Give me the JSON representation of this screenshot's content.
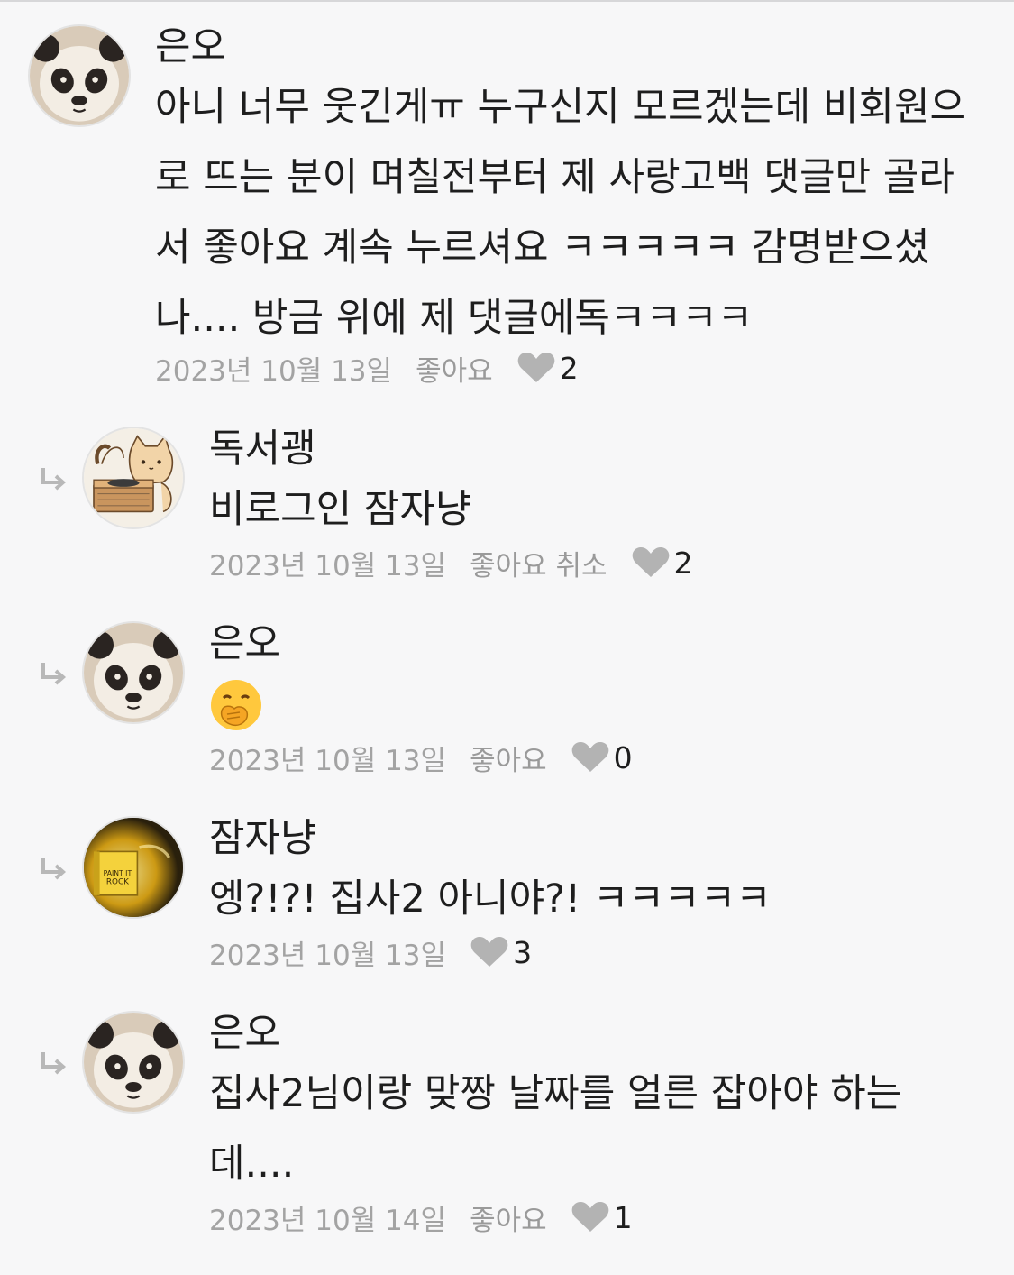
{
  "comments": [
    {
      "author": "은오",
      "text": "아니 너무 웃긴게ㅠ 누구신지 모르겠는데 비회원으로 뜨는 분이 며칠전부터 제 사랑고백 댓글만 골라서 좋아요 계속 누르셔요 ㅋㅋㅋㅋㅋ 감명받으셨나.... 방금 위에 제 댓글에독ㅋㅋㅋㅋ",
      "date": "2023년 10월 13일",
      "like_label": "좋아요",
      "like_count": "2",
      "avatar": "panda-avatar",
      "is_reply": false
    },
    {
      "author": "독서괭",
      "text": "비로그인 잠자냥",
      "date": "2023년 10월 13일",
      "like_label": "좋아요 취소",
      "like_count": "2",
      "avatar": "cat-turntable-avatar",
      "is_reply": true
    },
    {
      "author": "은오",
      "text": "",
      "emoji": "face-with-hand-over-mouth",
      "date": "2023년 10월 13일",
      "like_label": "좋아요",
      "like_count": "0",
      "avatar": "panda-avatar",
      "is_reply": true
    },
    {
      "author": "잠자냥",
      "text": "엥?!?! 집사2 아니야?! ㅋㅋㅋㅋㅋ",
      "date": "2023년 10월 13일",
      "like_label": "",
      "like_count": "3",
      "avatar": "paint-it-rock-book-avatar",
      "is_reply": true
    },
    {
      "author": "은오",
      "text": "집사2님이랑 맞짱 날짜를 얼른 잡아야 하는데....",
      "date": "2023년 10월 14일",
      "like_label": "좋아요",
      "like_count": "1",
      "avatar": "panda-avatar",
      "is_reply": true
    }
  ],
  "colors": {
    "background": "#f7f7f8",
    "text": "#1e1e1e",
    "meta_text": "#a3a3a3",
    "heart": "#b3b3b3",
    "reply_arrow": "#b8b8b8"
  }
}
